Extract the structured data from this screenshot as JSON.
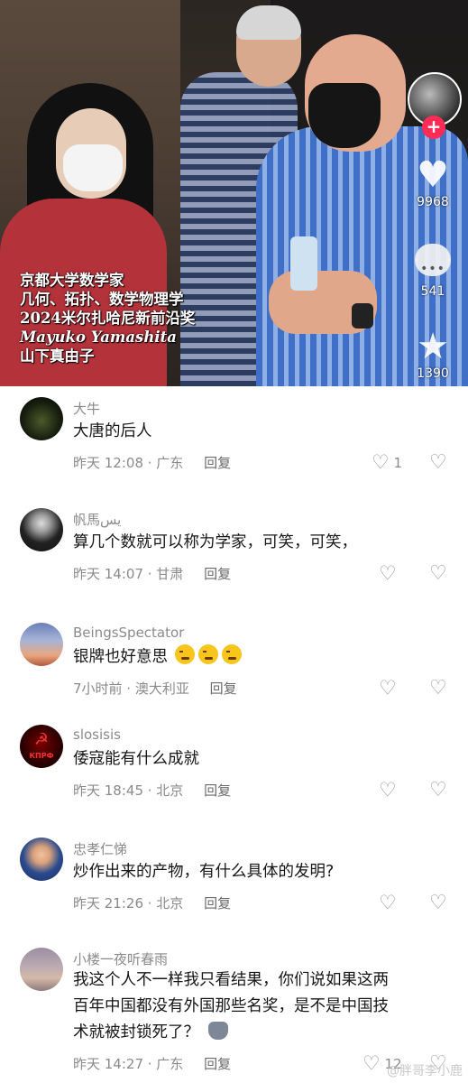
{
  "video": {
    "caption_lines": [
      "京都大学数学家",
      "几何、拓扑、数学物理学",
      "2024米尔扎哈尼新前沿奖",
      "Mayuko Yamashita",
      "山下真由子"
    ],
    "follow_plus": "+",
    "like_count": "9968",
    "comment_count": "541",
    "favorite_count": "1390"
  },
  "comments": [
    {
      "user": "大牛",
      "text": "大唐的后人",
      "time": "昨天 12:08 · 广东",
      "reply": "回复",
      "likes": "1"
    },
    {
      "user": "帆馬يس",
      "text": "算几个数就可以称为学家，可笑，可笑，",
      "time": "昨天 14:07 · 甘肃",
      "reply": "回复",
      "likes": ""
    },
    {
      "user": "BeingsSpectator",
      "text": "银牌也好意思",
      "time": "7小时前 · 澳大利亚",
      "reply": "回复",
      "likes": ""
    },
    {
      "user": "slosisis",
      "text": "倭寇能有什么成就",
      "time": "昨天 18:45 · 北京",
      "reply": "回复",
      "likes": ""
    },
    {
      "user": "忠孝仁悌",
      "text": "炒作出来的产物，有什么具体的发明?",
      "time": "昨天 21:26 · 北京",
      "reply": "回复",
      "likes": ""
    },
    {
      "user": "小楼一夜听春雨",
      "text_lines": [
        "我这个人不一样我只看结果，你们说如果这两",
        "百年中国都没有外国那些名奖，是不是中国技",
        "术就被封锁死了？"
      ],
      "time": "昨天 14:27 · 广东",
      "reply": "回复",
      "likes": "12"
    }
  ],
  "avatar4_label": "КПРФ",
  "watermark": "@胖哥李小鹿",
  "colors": {
    "accent": "#fe2c55",
    "meta": "#8a8a8a"
  }
}
